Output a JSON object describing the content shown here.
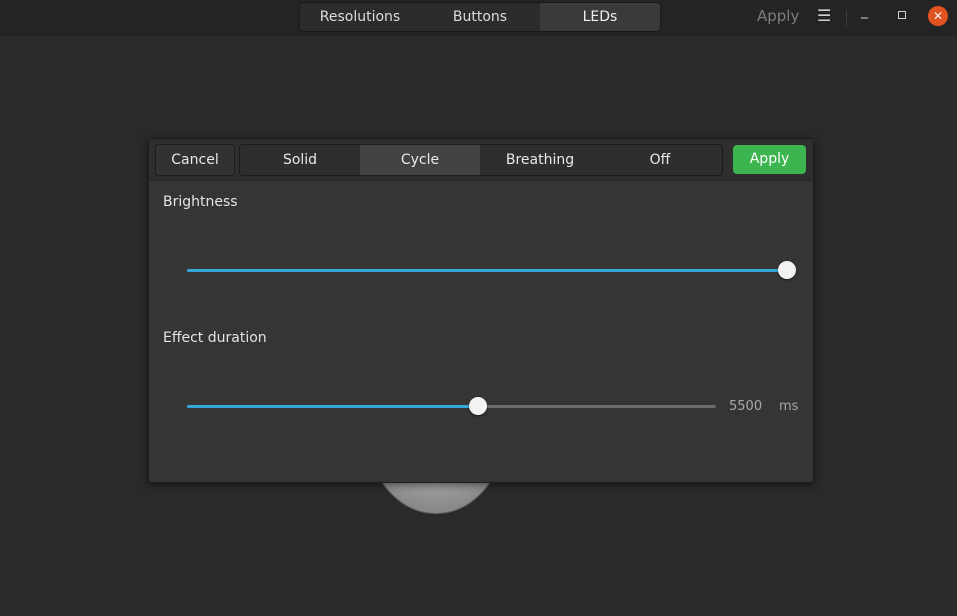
{
  "headerbar": {
    "tabs": [
      {
        "label": "Resolutions",
        "active": false
      },
      {
        "label": "Buttons",
        "active": false
      },
      {
        "label": "LEDs",
        "active": true
      }
    ],
    "apply_label": "Apply",
    "menu_icon": "hamburger-menu-icon",
    "minimize_icon": "minimize-icon",
    "maximize_icon": "maximize-icon",
    "close_icon": "close-icon",
    "close_color": "#e05220"
  },
  "led_popover": {
    "cancel_label": "Cancel",
    "modes": [
      {
        "label": "Solid",
        "active": false
      },
      {
        "label": "Cycle",
        "active": true
      },
      {
        "label": "Breathing",
        "active": false
      },
      {
        "label": "Off",
        "active": false
      }
    ],
    "apply_label": "Apply",
    "apply_color": "#3cb54f",
    "brightness": {
      "label": "Brightness",
      "value_fraction": 1.0
    },
    "effect_duration": {
      "label": "Effect duration",
      "value": "5500",
      "unit": "ms",
      "value_fraction": 0.55
    },
    "accent_color": "#35a7d8"
  }
}
